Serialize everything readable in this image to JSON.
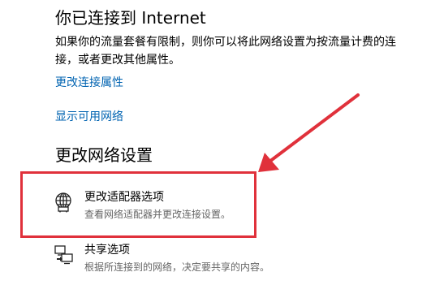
{
  "status": {
    "title": "你已连接到 Internet",
    "description": "如果你的流量套餐有限制，则你可以将此网络设置为按流量计费的连接，或者更改其他属性。"
  },
  "links": {
    "change_connection_properties": "更改连接属性",
    "show_available_networks": "显示可用网络"
  },
  "section": {
    "heading": "更改网络设置"
  },
  "options": [
    {
      "title": "更改适配器选项",
      "description": "查看网络适配器并更改连接设置。",
      "icon": "network-adapter-icon"
    },
    {
      "title": "共享选项",
      "description": "根据所连接到的网络，决定要共享的内容。",
      "icon": "sharing-options-icon"
    }
  ],
  "annotation": {
    "color": "#e0313b"
  },
  "colors": {
    "link": "#0063b1",
    "secondary_text": "#666666"
  }
}
